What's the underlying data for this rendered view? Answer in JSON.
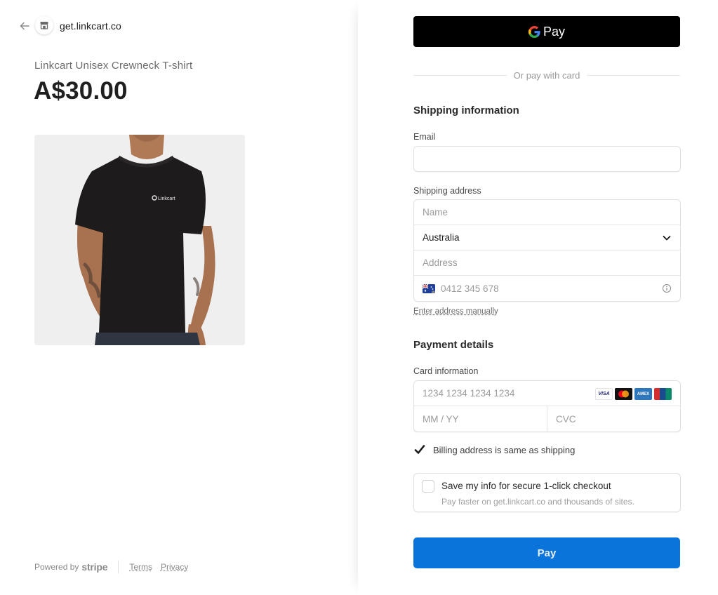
{
  "header": {
    "back_icon": "arrow-left-icon",
    "store_icon": "storefront-icon",
    "domain": "get.linkcart.co"
  },
  "product": {
    "name": "Linkcart Unisex Crewneck T-shirt",
    "price": "A$30.00",
    "image_alt": "Black crewneck t-shirt worn by model",
    "shirt_logo_text": "Linkcart"
  },
  "footer": {
    "powered_by": "Powered by",
    "brand": "stripe",
    "terms": "Terms",
    "privacy": "Privacy"
  },
  "wallet": {
    "gpay_label": "Pay",
    "divider_text": "Or pay with card"
  },
  "shipping": {
    "title": "Shipping information",
    "email_label": "Email",
    "email_value": "",
    "address_label": "Shipping address",
    "name_placeholder": "Name",
    "country_value": "Australia",
    "address_placeholder": "Address",
    "phone_placeholder": "0412 345 678",
    "manual_link": "Enter address manually"
  },
  "payment": {
    "title": "Payment details",
    "card_label": "Card information",
    "card_number_placeholder": "1234 1234 1234 1234",
    "expiry_placeholder": "MM / YY",
    "cvc_placeholder": "CVC",
    "card_brands": [
      "VISA",
      "mastercard",
      "AMEX",
      "UnionPay"
    ],
    "billing_same_label": "Billing address is same as shipping",
    "billing_same_checked": true,
    "save_info_title": "Save my info for secure 1-click checkout",
    "save_info_sub": "Pay faster on get.linkcart.co and thousands of sites.",
    "save_info_checked": false,
    "pay_label": "Pay"
  },
  "colors": {
    "pay_button": "#0a74da",
    "gpay_button": "#000000",
    "checkbox_checked": "#1a1a1a"
  }
}
